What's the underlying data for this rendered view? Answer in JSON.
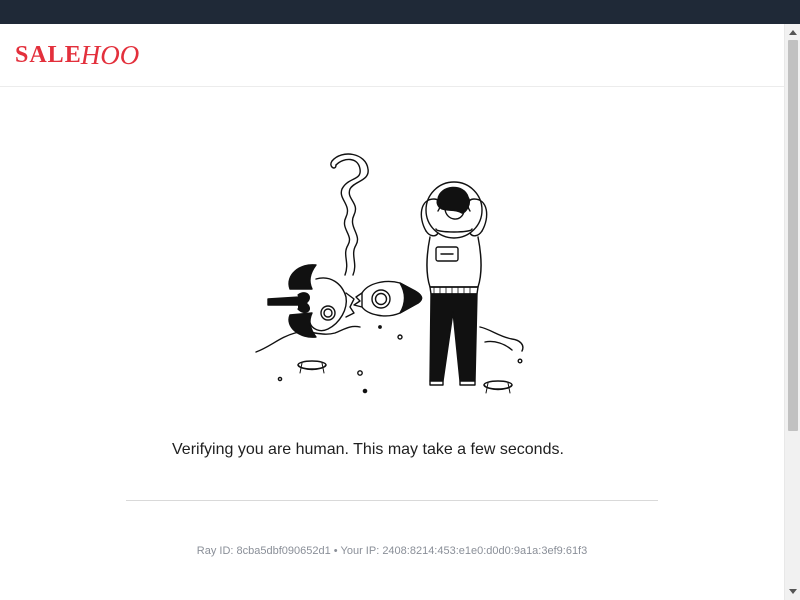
{
  "brand": {
    "logo_part1": "SALE",
    "logo_part2": "HOO",
    "logo_color": "#e3303c"
  },
  "illustration": {
    "icon": "astronaut-crashed-rocket-illustration"
  },
  "main": {
    "message": "Verifying you are human. This may take a few seconds."
  },
  "footer": {
    "ray_label": "Ray ID:",
    "ray_id": "8cba5dbf090652d1",
    "separator": "•",
    "ip_label": "Your IP:",
    "ip": "2408:8214:453:e1e0:d0d0:9a1a:3ef9:61f3"
  },
  "colors": {
    "top_bar": "#1f2937",
    "text": "#1f1f1f",
    "muted_text": "#8a8f98"
  }
}
